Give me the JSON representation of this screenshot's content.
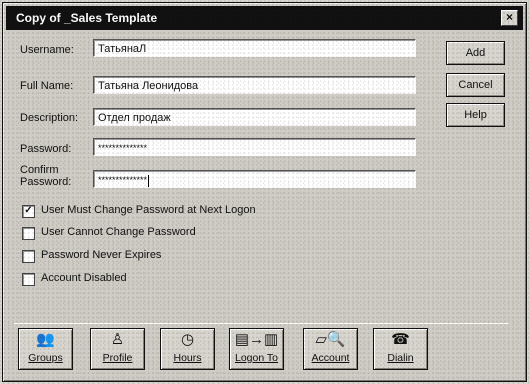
{
  "dialog": {
    "title": "Copy of _Sales Template",
    "close_icon": "close-icon",
    "colors": {
      "title_background": "#111111",
      "window_background": "#cfccc5",
      "field_background": "#ffffff"
    }
  },
  "fields": {
    "username": {
      "label": "Username:",
      "value": "ТатьянаЛ"
    },
    "full_name": {
      "label": "Full Name:",
      "value": "Татьяна Леонидова"
    },
    "description": {
      "label": "Description:",
      "value": "Отдел продаж"
    },
    "password": {
      "label": "Password:",
      "value": "**************"
    },
    "confirm_password": {
      "label": "Confirm Password:",
      "value": "**************"
    }
  },
  "side_buttons": {
    "add": "Add",
    "cancel": "Cancel",
    "help": "Help"
  },
  "checkboxes": [
    {
      "label": "User Must Change Password at Next Logon",
      "checked": true,
      "mark": "✓"
    },
    {
      "label": "User Cannot Change Password",
      "checked": false,
      "mark": ""
    },
    {
      "label": "Password Never Expires",
      "checked": false,
      "mark": ""
    },
    {
      "label": "Account Disabled",
      "checked": false,
      "mark": ""
    }
  ],
  "bottom_buttons": [
    {
      "label": "Groups",
      "icon_name": "groups-icon",
      "glyph": "👥"
    },
    {
      "label": "Profile",
      "icon_name": "profile-icon",
      "glyph": "♙"
    },
    {
      "label": "Hours",
      "icon_name": "clock-icon",
      "glyph": "◷"
    },
    {
      "label": "Logon To",
      "icon_name": "logon-to-icon",
      "glyph": "▤→▥"
    },
    {
      "label": "Account",
      "icon_name": "account-icon",
      "glyph": "▱🔍"
    },
    {
      "label": "Dialin",
      "icon_name": "dialin-icon",
      "glyph": "☎"
    }
  ]
}
